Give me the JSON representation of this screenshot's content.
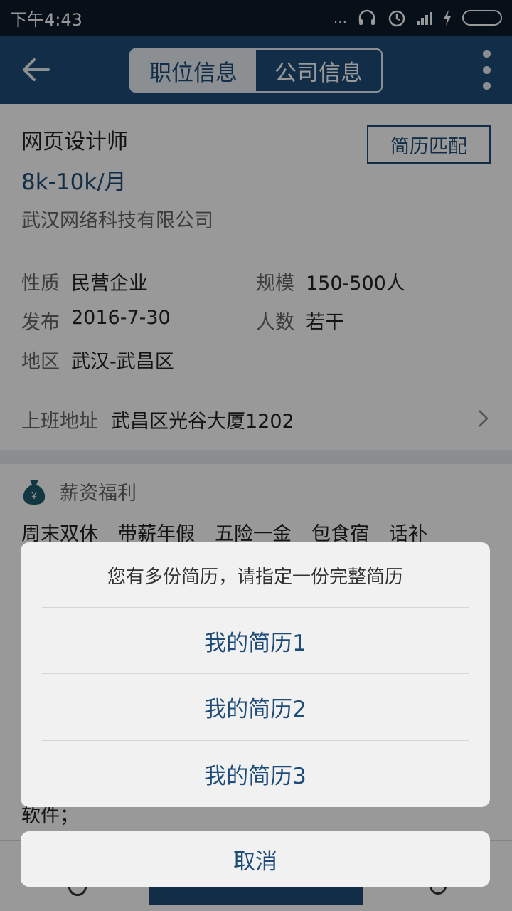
{
  "status_bar": {
    "time": "下午4:43",
    "dots": "..."
  },
  "header": {
    "tabs": [
      {
        "label": "职位信息",
        "active": true
      },
      {
        "label": "公司信息",
        "active": false
      }
    ]
  },
  "job": {
    "title": "网页设计师",
    "match_button": "简历匹配",
    "salary": "8k-10k/月",
    "company": "武汉网络科技有限公司",
    "details": {
      "nature_label": "性质",
      "nature_value": "民营企业",
      "scale_label": "规模",
      "scale_value": "150-500人",
      "publish_label": "发布",
      "publish_value": "2016-7-30",
      "count_label": "人数",
      "count_value": "若干",
      "region_label": "地区",
      "region_value": "武汉-武昌区"
    },
    "address_label": "上班地址",
    "address_value": "武昌区光谷大厦1202"
  },
  "benefits": {
    "title": "薪资福利",
    "tags": [
      "周末双休",
      "带薪年假",
      "五险一金",
      "包食宿",
      "话补"
    ]
  },
  "body_fragment": "软件；",
  "dialog": {
    "title": "您有多份简历，请指定一份完整简历",
    "options": [
      "我的简历1",
      "我的简历2",
      "我的简历3"
    ],
    "cancel": "取消"
  },
  "colors": {
    "primary": "#1e4c78",
    "status_bar": "#0c1a2a",
    "sheet_bg": "#f1f1f1"
  }
}
